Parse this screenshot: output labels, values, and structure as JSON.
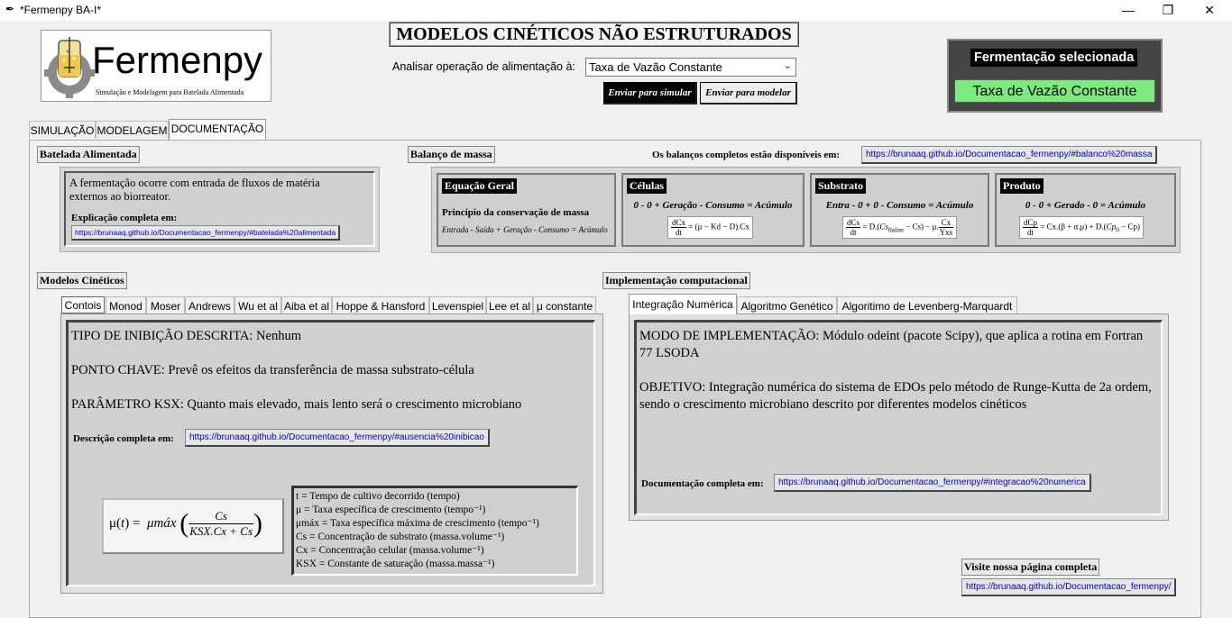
{
  "window": {
    "title": "*Fermenpy BA-I*",
    "minimize": "—",
    "maximize": "❐",
    "close": "✕"
  },
  "logo": {
    "name": "Fermenpy",
    "tagline": "Simulação e Modelagem para Batelada Alimentada"
  },
  "header": {
    "title": "MODELOS CINÉTICOS NÃO ESTRUTURADOS",
    "feed_label": "Analisar operação de alimentação à:",
    "feed_value": "Taxa de Vazão Constante",
    "send_simulate": "Enviar para simular",
    "send_model": "Enviar para modelar"
  },
  "selected": {
    "title": "Fermentação selecionada",
    "value": "Taxa de Vazão Constante"
  },
  "main_tabs": [
    "SIMULAÇÃO",
    "MODELAGEM",
    "DOCUMENTAÇÃO"
  ],
  "fed_batch": {
    "header": "Batelada Alimentada",
    "text": "A fermentação ocorre com entrada de fluxos de matéria externos ao biorreator.",
    "explain_label": "Explicação completa em:",
    "link": "https://brunaaq.github.io/Documentacao_fermenpy/#batelada%20alimentada"
  },
  "mass_balance": {
    "header": "Balanço de massa",
    "complete_label": "Os balanços completos estão disponíveis em:",
    "link": "https://brunaaq.github.io/Documentacao_fermenpy/#balanco%20massa",
    "general": {
      "title": "Equação Geral",
      "subtitle": "Princípio da conservação de massa",
      "equation": "Entrada - Saída + Geração - Consumo = Acúmulo"
    },
    "cells": {
      "title": "Células",
      "equation": "0 - 0 + Geração - Consumo = Acúmulo"
    },
    "substrate": {
      "title": "Substrato",
      "equation": "Entra - 0 + 0 - Consumo = Acúmulo"
    },
    "product": {
      "title": "Produto",
      "equation": "0 - 0 + Gerado - 0 = Acúmulo"
    }
  },
  "kinetic": {
    "header": "Modelos Cinéticos",
    "tabs": [
      "Contois",
      "Monod",
      "Moser",
      "Andrews",
      "Wu et al",
      "Aiba et al",
      "Hoppe & Hansford",
      "Levenspiel",
      "Lee et al",
      "μ constante"
    ],
    "inhibition": "TIPO DE INIBIÇÃO DESCRITA: Nenhum",
    "key_point": "PONTO CHAVE: Prevê os efeitos da transferência de massa substrato-célula",
    "parameter": "PARÂMETRO KSX: Quanto mais elevado, mais lento será o crescimento microbiano",
    "desc_label": "Descrição completa em:",
    "link": "https://brunaaq.github.io/Documentacao_fermenpy/#ausencia%20inibicao",
    "legend": [
      "t = Tempo de cultivo decorrido (tempo)",
      "μ = Taxa específica de crescimento (tempo⁻¹)",
      "μmáx = Taxa específica máxima de crescimento (tempo⁻¹)",
      "Cs = Concentração de substrato (massa.volume⁻¹)",
      "Cx = Concentração celular (massa.volume⁻¹)",
      "KSX = Constante de saturação (massa.massa⁻¹)"
    ]
  },
  "implementation": {
    "header": "Implementação computacional",
    "tabs": [
      "Integração Numérica",
      "Algoritmo Genético",
      "Algoritimo de Levenberg-Marquardt"
    ],
    "mode": "MODO DE IMPLEMENTAÇÃO: Módulo odeint (pacote Scipy), que aplica a rotina em Fortran 77 LSODA",
    "objective": "OBJETIVO: Integração numérica do sistema de EDOs pelo método de Runge-Kutta de 2a ordem, sendo o crescimento microbiano descrito por diferentes modelos cinéticos",
    "doc_label": "Documentação completa em:",
    "link": "https://brunaaq.github.io/Documentacao_fermenpy/#integracao%20numerica"
  },
  "visit": {
    "label": "Visite nossa página completa",
    "link": "https://brunaaq.github.io/Documentacao_fermenpy/"
  }
}
